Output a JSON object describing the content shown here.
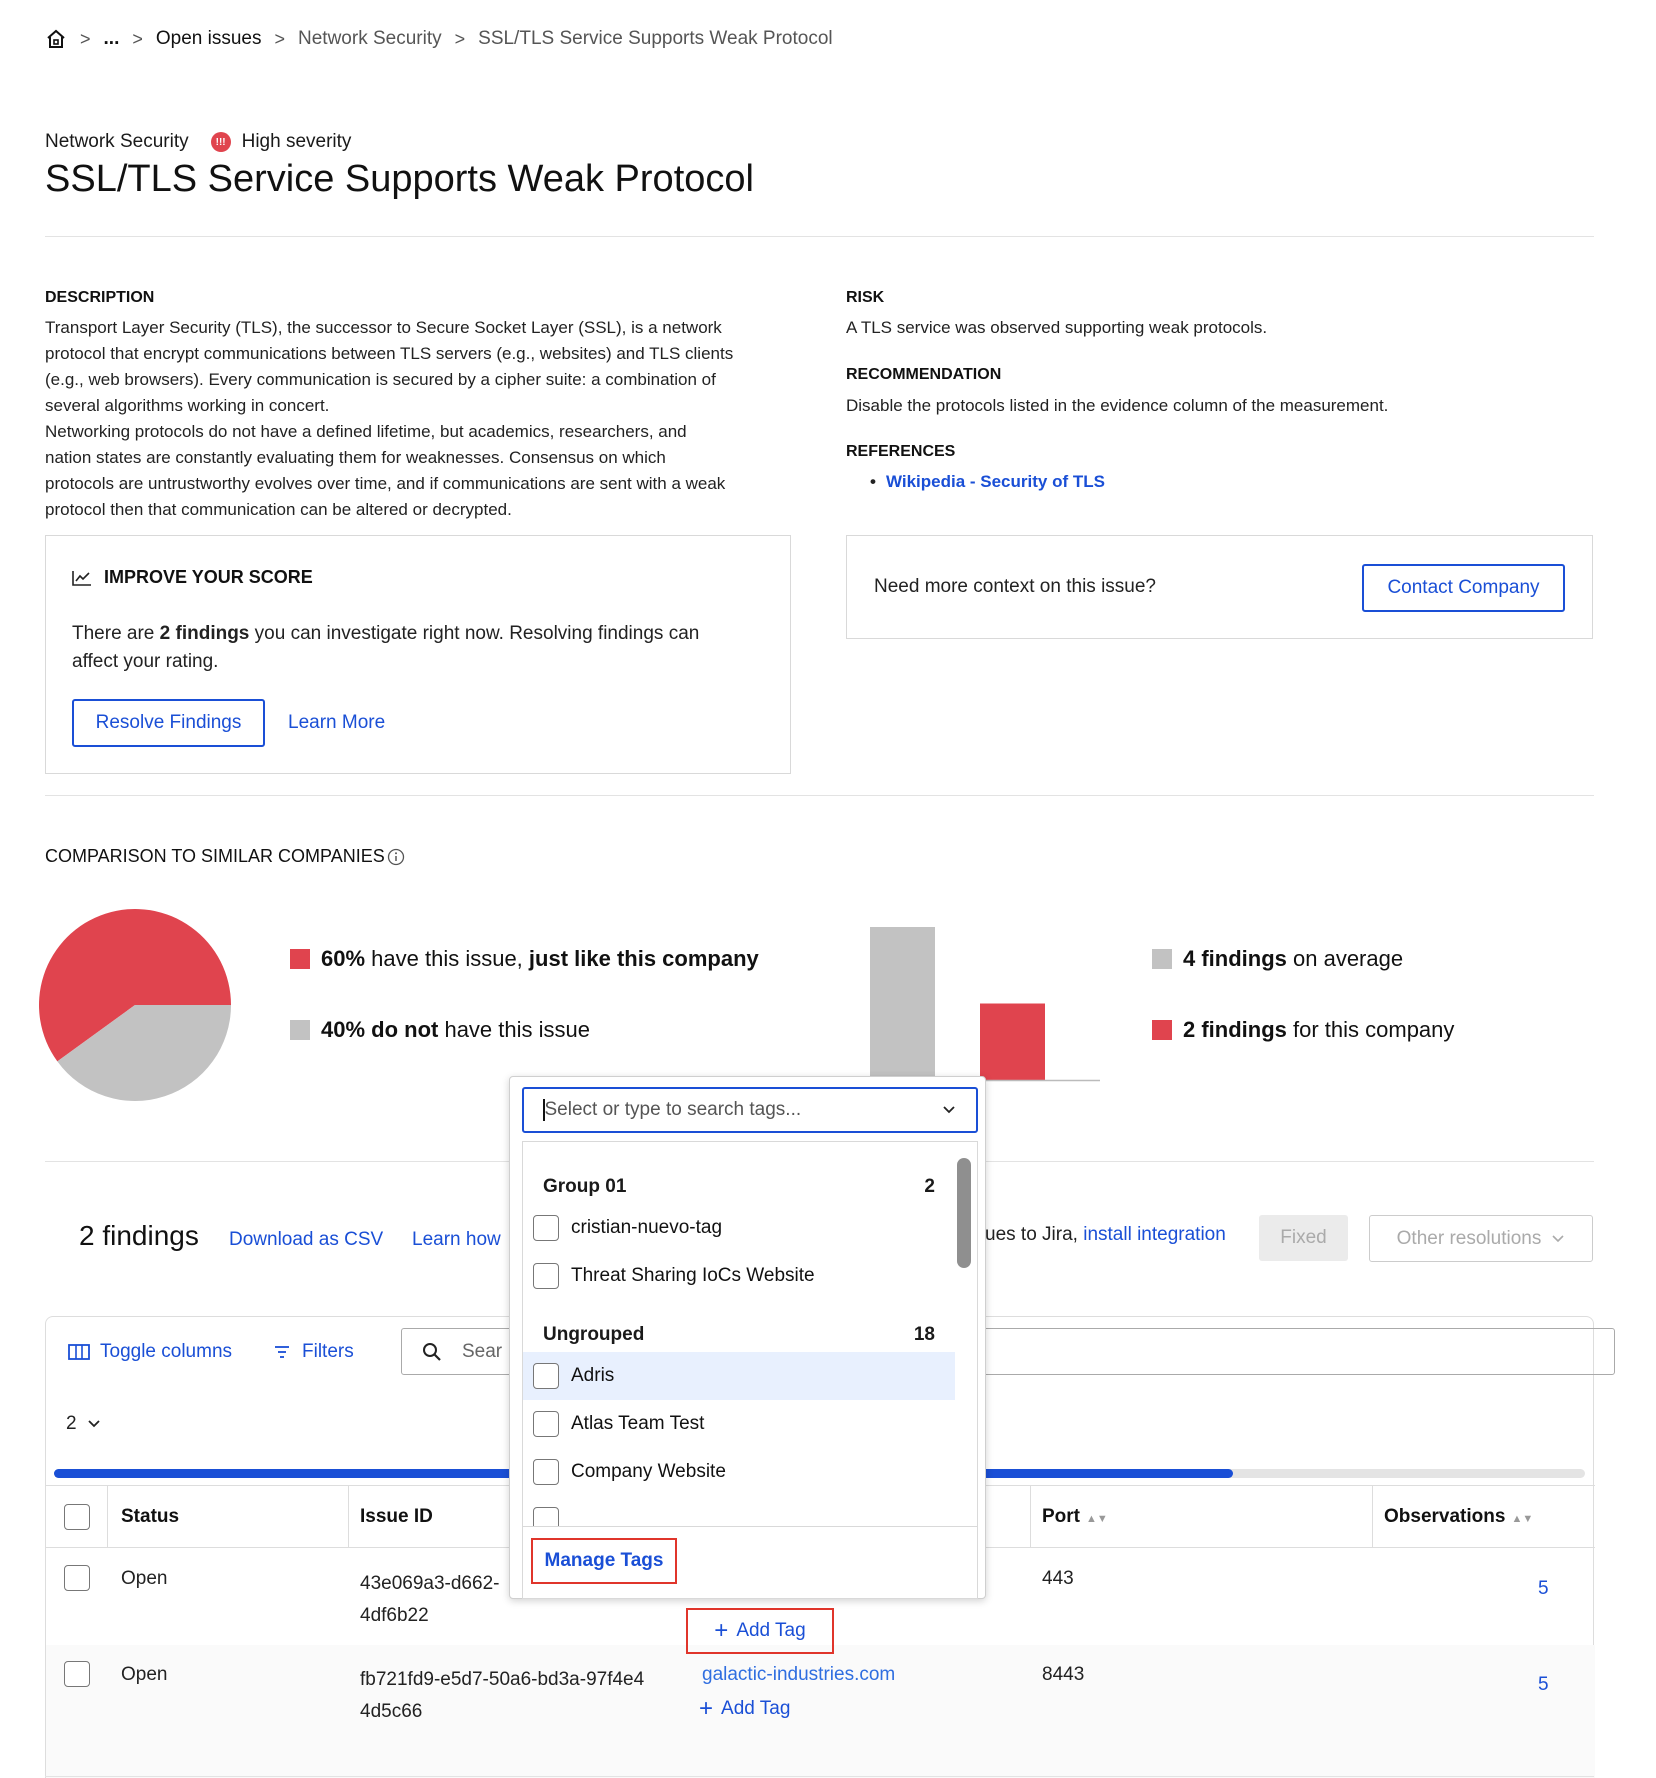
{
  "breadcrumb": {
    "items": [
      "...",
      "Open issues",
      "Network Security",
      "SSL/TLS Service Supports Weak Protocol"
    ]
  },
  "header": {
    "category": "Network Security",
    "severity": "High severity",
    "severity_icon_text": "!!!",
    "title": "SSL/TLS Service Supports Weak Protocol"
  },
  "description": {
    "heading": "DESCRIPTION",
    "lines": [
      "Transport Layer Security (TLS), the successor to Secure Socket Layer (SSL), is a network",
      "protocol that encrypt communications between TLS servers (e.g., websites) and TLS clients",
      "(e.g., web browsers). Every communication is secured by a cipher suite: a combination of",
      "several algorithms working in concert.",
      "Networking protocols do not have a defined lifetime, but academics, researchers, and",
      "nation states are constantly evaluating them for weaknesses. Consensus on which",
      "protocols are untrustworthy evolves over time, and if communications are sent with a weak",
      "protocol then that communication can be altered or decrypted."
    ]
  },
  "risk": {
    "heading": "RISK",
    "text": "A TLS service was observed supporting weak protocols."
  },
  "recommendation": {
    "heading": "RECOMMENDATION",
    "text": "Disable the protocols listed in the evidence column of the measurement."
  },
  "references": {
    "heading": "REFERENCES",
    "items": [
      "Wikipedia - Security of TLS"
    ]
  },
  "improve": {
    "heading": "IMPROVE YOUR SCORE",
    "text_pre": "There are ",
    "text_bold": "2 findings",
    "text_post": " you can investigate right now. Resolving findings can",
    "text_line2": "affect your rating.",
    "resolve_button": "Resolve Findings",
    "learn_more": "Learn More"
  },
  "context": {
    "question": "Need more context on this issue?",
    "button": "Contact Company"
  },
  "comparison": {
    "heading": "COMPARISON TO SIMILAR COMPANIES",
    "legend": [
      {
        "bold": "60%",
        "text": " have this issue, ",
        "bold2": "just like this company"
      },
      {
        "bold": "40% do not",
        "text": " have this issue"
      },
      {
        "bold": "4 findings",
        "text": " on average"
      },
      {
        "bold": "2 findings",
        "text": " for this company"
      }
    ],
    "colors": {
      "has_issue": "#e0444e",
      "no_issue": "#c2c2c2"
    }
  },
  "chart_data": [
    {
      "type": "pie",
      "categories": [
        "have this issue",
        "do not have this issue"
      ],
      "values": [
        60,
        40
      ]
    },
    {
      "type": "bar",
      "categories": [
        "on average",
        "for this company"
      ],
      "values": [
        4,
        2
      ]
    }
  ],
  "findings": {
    "count_label": "2 findings",
    "download_csv": "Download as CSV",
    "learn_how": "Learn how",
    "jira_text": "ues to Jira, ",
    "jira_link": "install integration",
    "fixed_button": "Fixed",
    "other_resolutions": "Other resolutions",
    "toggle_columns": "Toggle columns",
    "filters": "Filters",
    "search_placeholder": "Sear",
    "page_size": "2",
    "progress": 0.77,
    "columns": [
      "Status",
      "Issue ID",
      "Port",
      "Observations"
    ],
    "rows": [
      {
        "status": "Open",
        "id_line1": "43e069a3-d662-",
        "id_line2": "4df6b22",
        "asset": "",
        "port": "443",
        "observations": "5",
        "add_tag": "Add Tag"
      },
      {
        "status": "Open",
        "id_line1": "fb721fd9-e5d7-50a6-bd3a-97f4e4",
        "id_line2": "4d5c66",
        "asset": "galactic-industries.com",
        "port": "8443",
        "observations": "5",
        "add_tag": "Add Tag"
      }
    ]
  },
  "tag_popup": {
    "search_placeholder": "Select or type to search tags...",
    "groups": [
      {
        "name": "Group 01",
        "count": "2",
        "tags": [
          "cristian-nuevo-tag",
          "Threat Sharing IoCs Website"
        ]
      },
      {
        "name": "Ungrouped",
        "count": "18",
        "tags": [
          "Adris",
          "Atlas Team Test",
          "Company Website"
        ]
      }
    ],
    "manage_tags": "Manage Tags",
    "highlight_color": "#e8f0fe",
    "annotation_color": "#e0352b"
  }
}
